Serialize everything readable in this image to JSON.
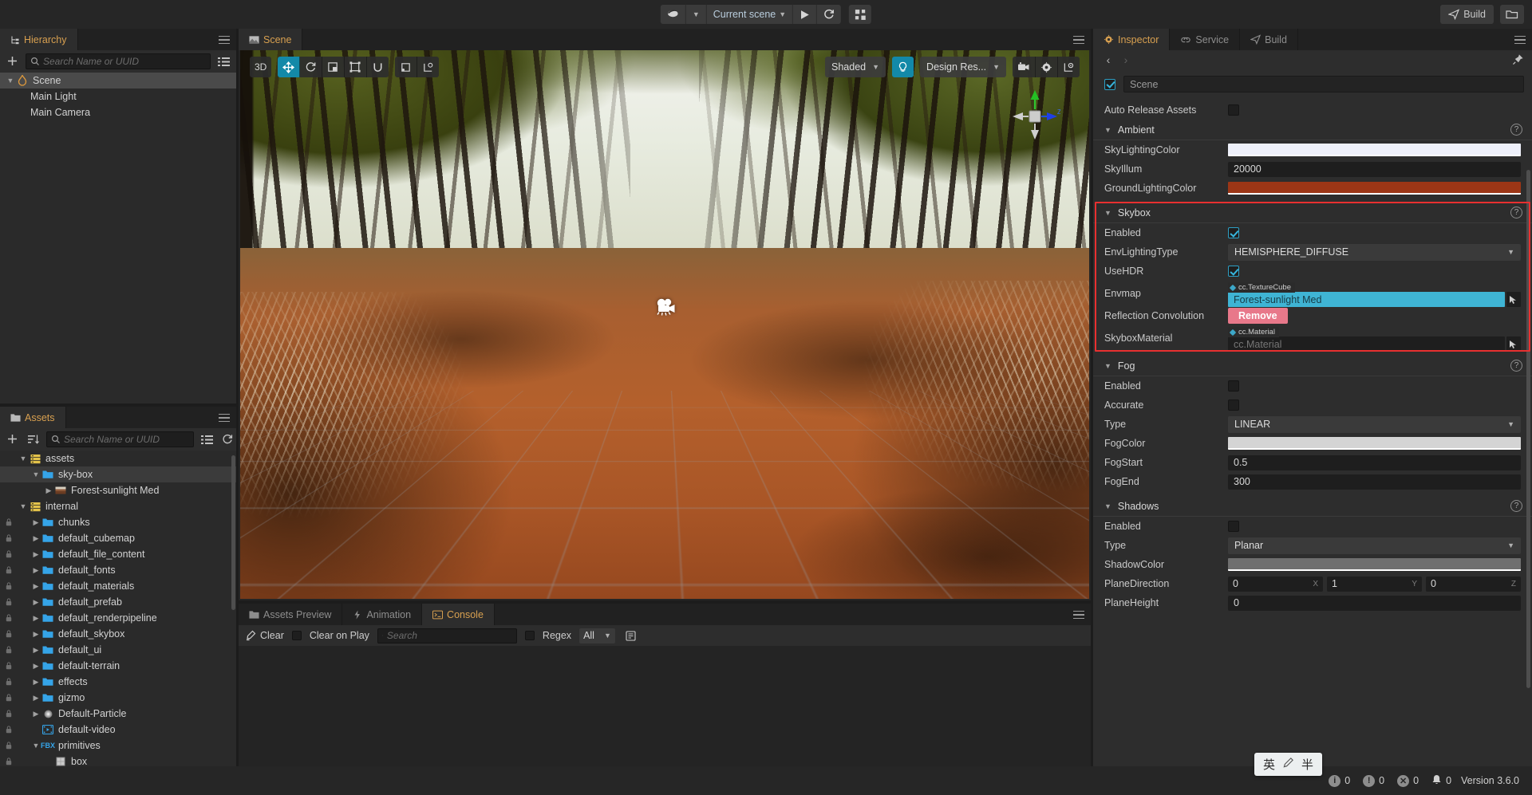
{
  "topbar": {
    "platform_icon": "cocos-logo-icon",
    "scene_selector": "Current scene",
    "play_icon": "play-icon",
    "refresh_icon": "refresh-icon",
    "grid_icon": "device-preview-icon",
    "build_label": "Build",
    "folder_icon": "open-folder-icon"
  },
  "hierarchy": {
    "tab_label": "Hierarchy",
    "tab_icon": "hierarchy-icon",
    "add_icon": "plus-icon",
    "search_placeholder": "Search Name or UUID",
    "search_value": "",
    "search_icon": "search-icon",
    "list_icon": "list-view-icon",
    "menu_icon": "panel-menu-icon",
    "nodes": [
      {
        "label": "Scene",
        "icon": "scene-flame-icon",
        "depth": 0,
        "arrow": "expanded",
        "selected": true
      },
      {
        "label": "Main Light",
        "icon": "",
        "depth": 1,
        "arrow": "none",
        "selected": false
      },
      {
        "label": "Main Camera",
        "icon": "",
        "depth": 1,
        "arrow": "none",
        "selected": false
      }
    ]
  },
  "assets": {
    "tab_label": "Assets",
    "tab_icon": "assets-folder-icon",
    "add_icon": "plus-icon",
    "sort_icon": "sort-icon",
    "search_placeholder": "Search Name or UUID",
    "search_value": "",
    "search_icon": "search-icon",
    "list_icon": "list-view-icon",
    "refresh_icon": "refresh-icon",
    "menu_icon": "panel-menu-icon",
    "nodes": [
      {
        "label": "assets",
        "icon": "db-assets-icon",
        "depth": 0,
        "arrow": "expanded",
        "lock": false,
        "selected": false
      },
      {
        "label": "sky-box",
        "icon": "folder-icon",
        "depth": 1,
        "arrow": "expanded",
        "lock": false,
        "selected": true
      },
      {
        "label": "Forest-sunlight Med",
        "icon": "texture-icon",
        "depth": 2,
        "arrow": "collapsed",
        "lock": false,
        "selected": false
      },
      {
        "label": "internal",
        "icon": "db-internal-icon",
        "depth": 0,
        "arrow": "expanded",
        "lock": false,
        "selected": false
      },
      {
        "label": "chunks",
        "icon": "folder-icon",
        "depth": 1,
        "arrow": "collapsed",
        "lock": true,
        "selected": false
      },
      {
        "label": "default_cubemap",
        "icon": "folder-icon",
        "depth": 1,
        "arrow": "collapsed",
        "lock": true,
        "selected": false
      },
      {
        "label": "default_file_content",
        "icon": "folder-icon",
        "depth": 1,
        "arrow": "collapsed",
        "lock": true,
        "selected": false
      },
      {
        "label": "default_fonts",
        "icon": "folder-icon",
        "depth": 1,
        "arrow": "collapsed",
        "lock": true,
        "selected": false
      },
      {
        "label": "default_materials",
        "icon": "folder-icon",
        "depth": 1,
        "arrow": "collapsed",
        "lock": true,
        "selected": false
      },
      {
        "label": "default_prefab",
        "icon": "folder-icon",
        "depth": 1,
        "arrow": "collapsed",
        "lock": true,
        "selected": false
      },
      {
        "label": "default_renderpipeline",
        "icon": "folder-icon",
        "depth": 1,
        "arrow": "collapsed",
        "lock": true,
        "selected": false
      },
      {
        "label": "default_skybox",
        "icon": "folder-icon",
        "depth": 1,
        "arrow": "collapsed",
        "lock": true,
        "selected": false
      },
      {
        "label": "default_ui",
        "icon": "folder-icon",
        "depth": 1,
        "arrow": "collapsed",
        "lock": true,
        "selected": false
      },
      {
        "label": "default-terrain",
        "icon": "folder-icon",
        "depth": 1,
        "arrow": "collapsed",
        "lock": true,
        "selected": false
      },
      {
        "label": "effects",
        "icon": "folder-icon",
        "depth": 1,
        "arrow": "collapsed",
        "lock": true,
        "selected": false
      },
      {
        "label": "gizmo",
        "icon": "folder-icon",
        "depth": 1,
        "arrow": "collapsed",
        "lock": true,
        "selected": false
      },
      {
        "label": "Default-Particle",
        "icon": "particle-icon",
        "depth": 1,
        "arrow": "collapsed",
        "lock": true,
        "selected": false
      },
      {
        "label": "default-video",
        "icon": "video-icon",
        "depth": 1,
        "arrow": "none",
        "lock": true,
        "selected": false
      },
      {
        "label": "primitives",
        "icon": "fbx-icon",
        "depth": 1,
        "arrow": "expanded",
        "lock": true,
        "selected": false
      },
      {
        "label": "box",
        "icon": "mesh-icon",
        "depth": 2,
        "arrow": "none",
        "lock": true,
        "selected": false
      }
    ]
  },
  "scene_panel": {
    "tab_label": "Scene",
    "tab_icon": "scene-image-icon",
    "menu_icon": "panel-menu-icon",
    "toolbar_left": [
      {
        "name": "3d-toggle",
        "label": "3D",
        "active": false
      },
      {
        "name": "move-tool",
        "label": "move-icon",
        "active": true
      },
      {
        "name": "rotate-tool",
        "label": "rotate-icon",
        "active": false
      },
      {
        "name": "scale-tool",
        "label": "scale-icon",
        "active": false
      },
      {
        "name": "rect-tool",
        "label": "rect-transform-icon",
        "active": false
      },
      {
        "name": "magnet-tool",
        "label": "magnet-icon",
        "active": false
      }
    ],
    "toolbar_left2": [
      {
        "name": "pivot-toggle",
        "label": "pivot-icon",
        "active": false
      },
      {
        "name": "coordinate-toggle",
        "label": "local-global-icon",
        "active": false
      }
    ],
    "shading_mode": "Shaded",
    "lighting_icon": "lightbulb-icon",
    "resolution_mode": "Design Res...",
    "camera_icon": "scene-camera-icon",
    "gear_icon": "gear-icon",
    "layout_icon": "gizmo-settings-icon",
    "axis_gizmo": {
      "x_label": "",
      "y_label": "",
      "z_label": "Z"
    },
    "selected_node_gizmo": "camera-gizmo-icon"
  },
  "console_panel": {
    "tabs": [
      {
        "label": "Assets Preview",
        "icon": "assets-preview-icon",
        "active": false
      },
      {
        "label": "Animation",
        "icon": "animation-icon",
        "active": false
      },
      {
        "label": "Console",
        "icon": "console-icon",
        "active": true
      }
    ],
    "menu_icon": "panel-menu-icon",
    "clear_label": "Clear",
    "clear_icon": "broom-icon",
    "clear_on_play_label": "Clear on Play",
    "search_placeholder": "Search",
    "search_value": "",
    "search_icon": "search-icon",
    "regex_label": "Regex",
    "filter_value": "All",
    "log_mode_icon": "log-list-icon",
    "messages": []
  },
  "inspector": {
    "tabs": [
      {
        "label": "Inspector",
        "icon": "gear-icon",
        "active": true
      },
      {
        "label": "Service",
        "icon": "service-link-icon",
        "active": false
      },
      {
        "label": "Build",
        "icon": "build-plane-icon",
        "active": false
      }
    ],
    "menu_icon": "panel-menu-icon",
    "back_icon": "chevron-left-icon",
    "forward_icon": "chevron-right-icon",
    "pin_icon": "pin-icon",
    "node_name": "Scene",
    "node_enabled": true,
    "auto_release_assets": {
      "label": "Auto Release Assets",
      "checked": false
    },
    "sections": [
      {
        "name": "Ambient",
        "title": "Ambient",
        "collapsed": false,
        "help_icon": "help-icon",
        "highlighted": false,
        "rows": [
          {
            "label": "SkyLightingColor",
            "type": "color",
            "value": "#eef0fa"
          },
          {
            "label": "SkyIllum",
            "type": "number",
            "value": "20000"
          },
          {
            "label": "GroundLightingColor",
            "type": "color",
            "value": "#9c3616"
          }
        ]
      },
      {
        "name": "Skybox",
        "title": "Skybox",
        "collapsed": false,
        "help_icon": "help-icon",
        "highlighted": true,
        "rows": [
          {
            "label": "Enabled",
            "type": "checkbox",
            "value": true
          },
          {
            "label": "EnvLightingType",
            "type": "select",
            "value": "HEMISPHERE_DIFFUSE"
          },
          {
            "label": "UseHDR",
            "type": "checkbox",
            "value": true
          },
          {
            "label": "Envmap",
            "type": "asset",
            "tag": "cc.TextureCube",
            "value": "Forest-sunlight Med",
            "filled": true
          },
          {
            "label": "Reflection Convolution",
            "type": "button",
            "value": "Remove"
          },
          {
            "label": "SkyboxMaterial",
            "type": "asset",
            "tag": "cc.Material",
            "value": "cc.Material",
            "filled": false
          }
        ]
      },
      {
        "name": "Fog",
        "title": "Fog",
        "collapsed": false,
        "help_icon": "help-icon",
        "highlighted": false,
        "rows": [
          {
            "label": "Enabled",
            "type": "checkbox",
            "value": false
          },
          {
            "label": "Accurate",
            "type": "checkbox",
            "value": false
          },
          {
            "label": "Type",
            "type": "select",
            "value": "LINEAR"
          },
          {
            "label": "FogColor",
            "type": "color",
            "value": "#d4d4d4"
          },
          {
            "label": "FogStart",
            "type": "number",
            "value": "0.5"
          },
          {
            "label": "FogEnd",
            "type": "number",
            "value": "300"
          }
        ]
      },
      {
        "name": "Shadows",
        "title": "Shadows",
        "collapsed": false,
        "help_icon": "help-icon",
        "highlighted": false,
        "rows": [
          {
            "label": "Enabled",
            "type": "checkbox",
            "value": false
          },
          {
            "label": "Type",
            "type": "select",
            "value": "Planar"
          },
          {
            "label": "ShadowColor",
            "type": "color",
            "value": "#6f6f6f"
          },
          {
            "label": "PlaneDirection",
            "type": "vec3",
            "value": [
              "0",
              "1",
              "0"
            ],
            "axes": [
              "X",
              "Y",
              "Z"
            ]
          },
          {
            "label": "PlaneHeight",
            "type": "number",
            "value": "0"
          }
        ]
      }
    ]
  },
  "statusbar": {
    "info_count": "0",
    "warn_count": "0",
    "error_count": "0",
    "bell_count": "0",
    "version": "Version 3.6.0",
    "info_icon": "info-icon",
    "warn_icon": "warning-icon",
    "error_icon": "error-icon",
    "bell_icon": "bell-icon"
  },
  "ime_popup": {
    "mode": "英",
    "pen": "pen-icon",
    "punct": "半"
  },
  "colors": {
    "accent": "#d8a050",
    "highlight_red": "#e83030",
    "teal": "#1389a8",
    "asset_selected": "#3fb4d4",
    "remove_btn": "#e8788a"
  }
}
